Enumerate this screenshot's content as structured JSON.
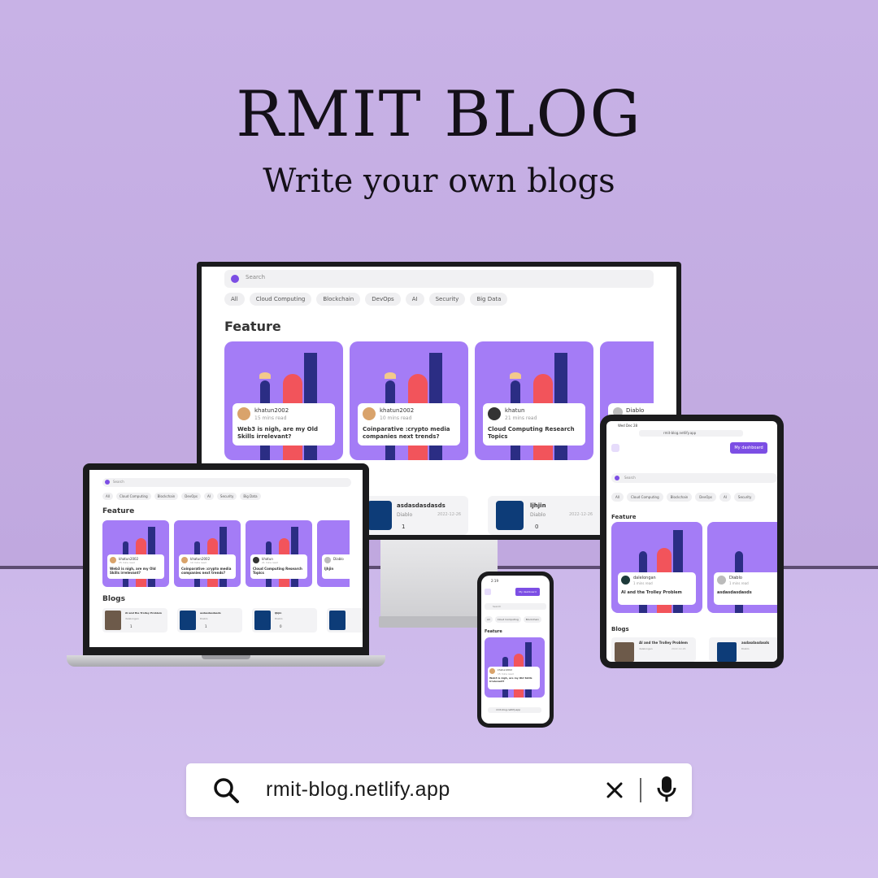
{
  "hero": {
    "title": "RMIT BLOG",
    "subtitle": "Write your own blogs"
  },
  "app": {
    "search_placeholder": "Search",
    "categories": [
      "All",
      "Cloud Computing",
      "Blockchain",
      "DevOps",
      "AI",
      "Security",
      "Big Data"
    ],
    "feature_heading": "Feature",
    "blogs_heading": "Blogs",
    "dashboard_button": "My dashboard",
    "features": [
      {
        "author": "khatun2002",
        "read": "15 mins read",
        "title": "Web3 is nigh, are my Old Skills irrelevant?"
      },
      {
        "author": "khatun2002",
        "read": "10 mins read",
        "title": "Coinparative :crypto media companies next trends?"
      },
      {
        "author": "khatun",
        "read": "21 mins read",
        "title": "Cloud Computing Research Topics"
      },
      {
        "author": "Diablo",
        "read": "1 mins read",
        "title": "ljhjin"
      }
    ],
    "tablet_features": [
      {
        "author": "dalelongan",
        "read": "1 mins read",
        "title": "AI and the Trolley Problem"
      },
      {
        "author": "Diablo",
        "read": "1 mins read",
        "title": "asdasdasdasds"
      }
    ],
    "blogs": [
      {
        "title": "AI and the Trolley Problem",
        "author": "dalelongan",
        "date": "2022-12-26",
        "likes": "1"
      },
      {
        "title": "asdasdasdasds",
        "author": "Diablo",
        "date": "2022-12-26",
        "likes": "1"
      },
      {
        "title": "ljhjin",
        "author": "Diablo",
        "date": "2022-12-26",
        "likes": "0"
      }
    ],
    "url": "rmit-blog.netlify.app",
    "tablet_time": "Wed Dec 28",
    "phone_time": "2:19"
  },
  "addressbar": {
    "url": "rmit-blog.netlify.app",
    "search_icon": "search-icon",
    "clear_icon": "close-icon",
    "mic_icon": "microphone-icon"
  },
  "colors": {
    "background": "#c4aee2",
    "accent": "#7c4ee4",
    "card": "#a47cf6",
    "art_navy": "#2b2d84",
    "art_red": "#f2545b"
  }
}
